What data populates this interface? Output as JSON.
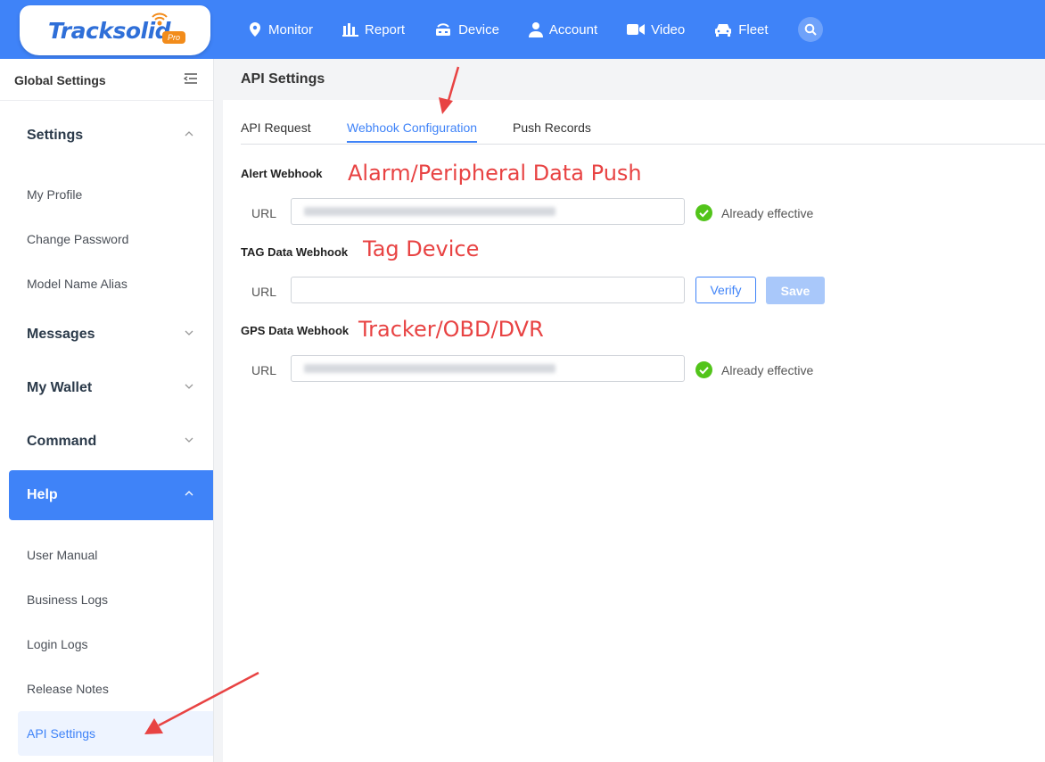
{
  "brand": {
    "name": "Tracksolid",
    "badge": "Pro"
  },
  "nav": {
    "items": [
      {
        "label": "Monitor",
        "icon": "map-pin-icon"
      },
      {
        "label": "Report",
        "icon": "bar-chart-icon"
      },
      {
        "label": "Device",
        "icon": "device-icon"
      },
      {
        "label": "Account",
        "icon": "user-icon"
      },
      {
        "label": "Video",
        "icon": "video-camera-icon"
      },
      {
        "label": "Fleet",
        "icon": "car-icon"
      }
    ],
    "search_icon": "search-icon"
  },
  "sidebar": {
    "title": "Global Settings",
    "groups": {
      "settings": "Settings",
      "messages": "Messages",
      "wallet": "My Wallet",
      "command": "Command",
      "help": "Help"
    },
    "settings_items": [
      "My Profile",
      "Change Password",
      "Model Name Alias"
    ],
    "help_items": [
      "User Manual",
      "Business Logs",
      "Login Logs",
      "Release Notes",
      "API Settings"
    ]
  },
  "main": {
    "title": "API Settings",
    "tabs": [
      "API Request",
      "Webhook Configuration",
      "Push Records"
    ],
    "active_tab": "Webhook Configuration",
    "sections": {
      "alert": {
        "label": "Alert Webhook",
        "annotation": "Alarm/Peripheral Data Push",
        "url_label": "URL",
        "status": "Already effective"
      },
      "tag": {
        "label": "TAG Data Webhook",
        "annotation": "Tag Device",
        "url_label": "URL",
        "verify": "Verify",
        "save": "Save"
      },
      "gps": {
        "label": "GPS Data Webhook",
        "annotation": "Tracker/OBD/DVR",
        "url_label": "URL",
        "status": "Already effective"
      }
    }
  },
  "colors": {
    "primary": "#3f83f8",
    "annotation": "#e84343",
    "success": "#52c41a",
    "logo_orange": "#f28c1b"
  }
}
